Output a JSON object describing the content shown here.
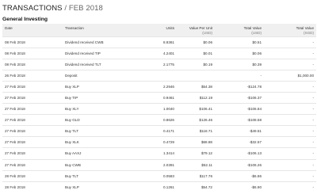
{
  "header": {
    "title": "TRANSACTIONS",
    "separator": " / ",
    "period": "FEB 2018"
  },
  "section": {
    "title": "General Investing"
  },
  "table": {
    "columns": {
      "date": "Date",
      "transaction": "Transaction",
      "units": "Units",
      "value_per_unit": "Value Per Unit",
      "value_per_unit_unit": "(USD)",
      "total_value": "Total Value",
      "total_value_unit": "(USD)",
      "total_value_sgd": "Total Value",
      "total_value_sgd_unit": "(SGD)"
    },
    "rows": [
      {
        "date": "08 Feb 2018",
        "transaction": "Dividend received CWB",
        "units": "8.9361",
        "vpu": "$0.06",
        "tv": "$0.51",
        "tv_sgd": "-"
      },
      {
        "date": "08 Feb 2018",
        "transaction": "Dividend received TIP",
        "units": "4.2401",
        "vpu": "$0.01",
        "tv": "$0.06",
        "tv_sgd": "-"
      },
      {
        "date": "08 Feb 2018",
        "transaction": "Dividend received TLT",
        "units": "2.1775",
        "vpu": "$0.19",
        "tv": "$0.39",
        "tv_sgd": "-"
      },
      {
        "date": "26 Feb 2018",
        "transaction": "Deposit",
        "units": "",
        "vpu": "",
        "tv": "-",
        "tv_sgd": "$1,000.00"
      },
      {
        "date": "27 Feb 2018",
        "transaction": "Buy XLP",
        "units": "2.2946",
        "vpu": "$54.38",
        "tv": "-$124.78",
        "tv_sgd": "-"
      },
      {
        "date": "27 Feb 2018",
        "transaction": "Buy TIP",
        "units": "0.9461",
        "vpu": "$112.19",
        "tv": "-$106.37",
        "tv_sgd": "-"
      },
      {
        "date": "27 Feb 2018",
        "transaction": "Buy XLY",
        "units": "1.0040",
        "vpu": "$106.41",
        "tv": "-$106.84",
        "tv_sgd": "-"
      },
      {
        "date": "27 Feb 2018",
        "transaction": "Buy GLD",
        "units": "0.8626",
        "vpu": "$126.46",
        "tv": "-$108.58",
        "tv_sgd": "-"
      },
      {
        "date": "27 Feb 2018",
        "transaction": "Buy TLT",
        "units": "0.4171",
        "vpu": "$118.71",
        "tv": "-$49.51",
        "tv_sgd": "-"
      },
      {
        "date": "27 Feb 2018",
        "transaction": "Buy XLK",
        "units": "0.4729",
        "vpu": "$68.88",
        "tv": "-$32.57",
        "tv_sgd": "-"
      },
      {
        "date": "27 Feb 2018",
        "transaction": "Buy AAXJ",
        "units": "1.3414",
        "vpu": "$79.12",
        "tv": "-$106.13",
        "tv_sgd": "-"
      },
      {
        "date": "27 Feb 2018",
        "transaction": "Buy CWB",
        "units": "2.0391",
        "vpu": "$52.11",
        "tv": "-$106.26",
        "tv_sgd": "-"
      },
      {
        "date": "28 Feb 2018",
        "transaction": "Buy TLT",
        "units": "0.0583",
        "vpu": "$117.76",
        "tv": "-$6.86",
        "tv_sgd": "-"
      },
      {
        "date": "28 Feb 2018",
        "transaction": "Buy XLP",
        "units": "0.1261",
        "vpu": "$54.72",
        "tv": "-$6.90",
        "tv_sgd": "-"
      }
    ]
  }
}
